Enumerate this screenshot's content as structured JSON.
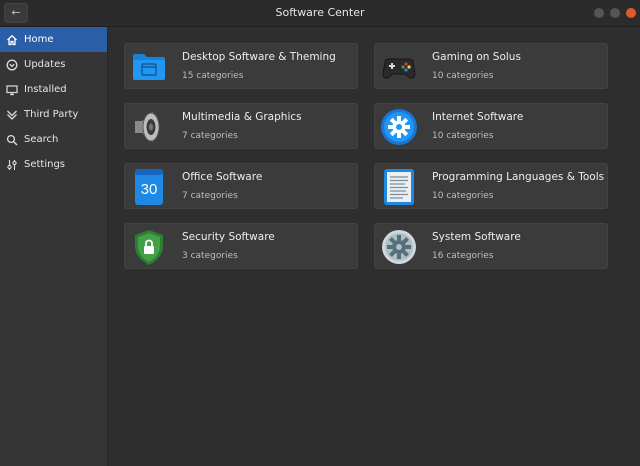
{
  "window": {
    "title": "Software Center"
  },
  "header": {
    "back_icon": "back-arrow-icon",
    "back_glyph": "←"
  },
  "sidebar": {
    "items": [
      {
        "label": "Home",
        "icon": "home-icon"
      },
      {
        "label": "Updates",
        "icon": "updates-icon"
      },
      {
        "label": "Installed",
        "icon": "installed-icon"
      },
      {
        "label": "Third Party",
        "icon": "third-party-icon"
      },
      {
        "label": "Search",
        "icon": "search-icon"
      },
      {
        "label": "Settings",
        "icon": "settings-icon"
      }
    ],
    "selected": "Home"
  },
  "categories": [
    {
      "title": "Desktop Software & Theming",
      "subtitle": "15 categories",
      "icon": "folder-icon"
    },
    {
      "title": "Gaming on Solus",
      "subtitle": "10 categories",
      "icon": "gamepad-icon"
    },
    {
      "title": "Multimedia & Graphics",
      "subtitle": "7 categories",
      "icon": "speaker-icon"
    },
    {
      "title": "Internet Software",
      "subtitle": "10 categories",
      "icon": "internet-gear-icon"
    },
    {
      "title": "Office Software",
      "subtitle": "7 categories",
      "icon": "calendar-icon",
      "icon_text": "30"
    },
    {
      "title": "Programming Languages & Tools",
      "subtitle": "10 categories",
      "icon": "text-document-icon"
    },
    {
      "title": "Security Software",
      "subtitle": "3 categories",
      "icon": "security-shield-icon"
    },
    {
      "title": "System Software",
      "subtitle": "16 categories",
      "icon": "system-settings-icon"
    }
  ],
  "colors": {
    "accent": "#2a5fa8",
    "close_button": "#e0582d",
    "card_background": "#3b3b3b",
    "window_background": "#2e2e2e"
  }
}
